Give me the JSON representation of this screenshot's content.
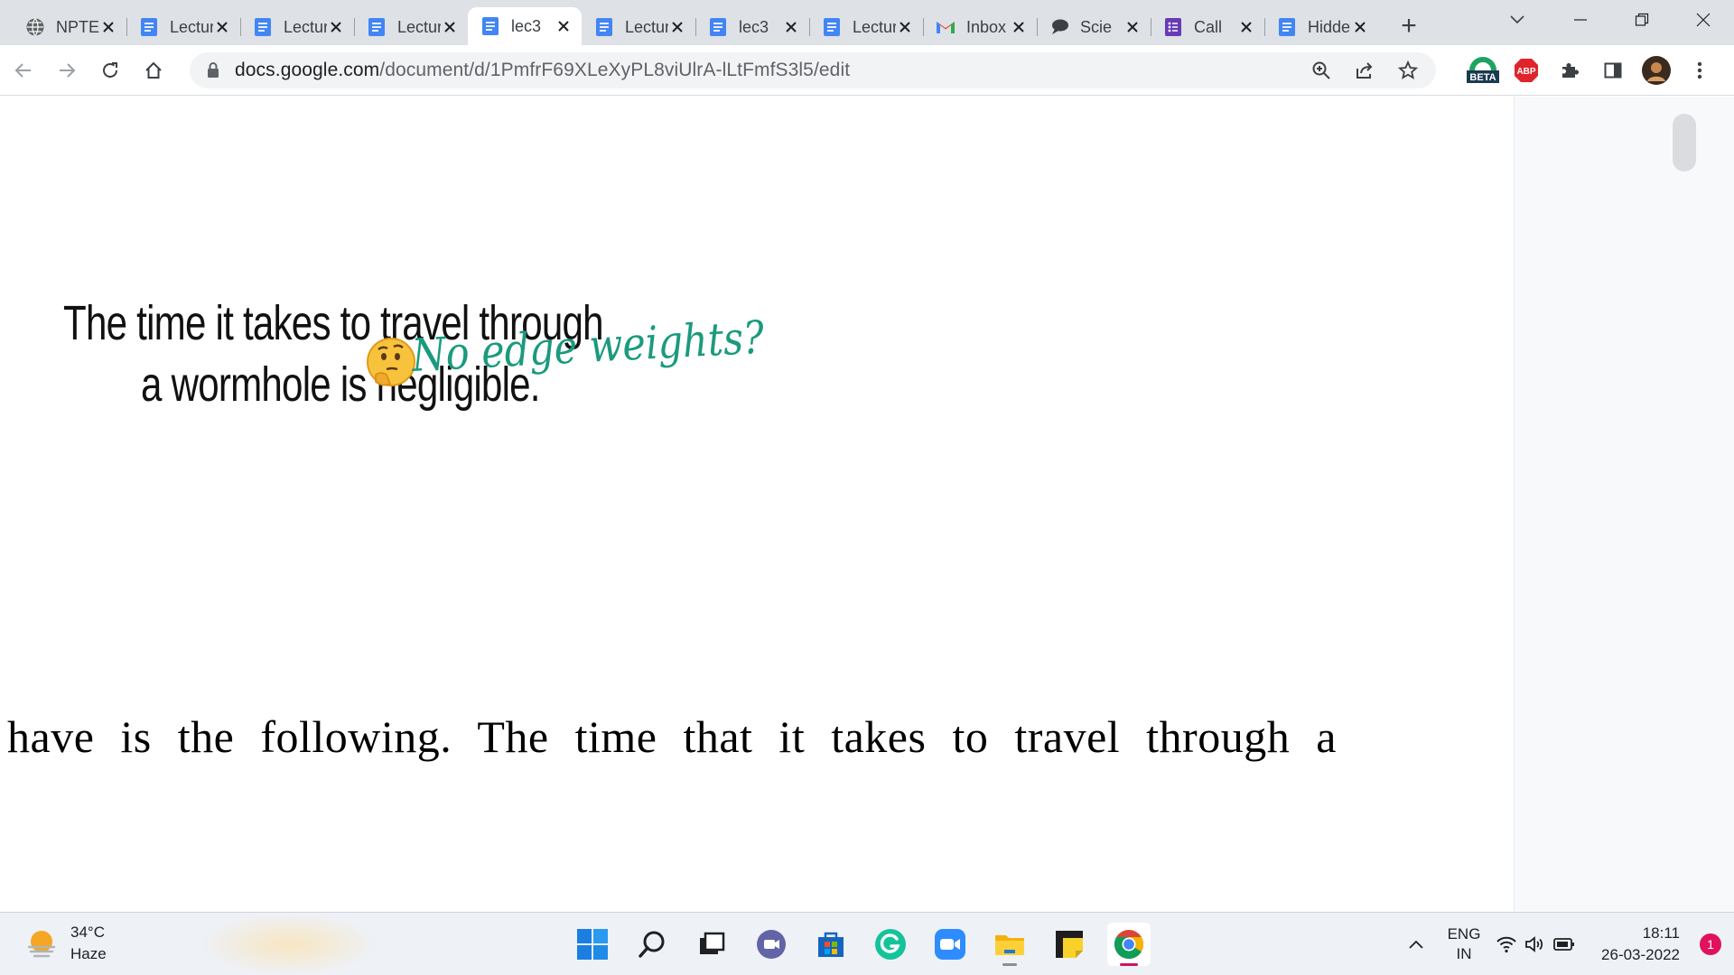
{
  "browser": {
    "tabs": [
      {
        "title": "NPTEL",
        "favicon": "globe-icon",
        "active": false
      },
      {
        "title": "Lecture",
        "favicon": "google-docs-icon",
        "active": false
      },
      {
        "title": "Lecture",
        "favicon": "google-docs-icon",
        "active": false
      },
      {
        "title": "Lecture",
        "favicon": "google-docs-icon",
        "active": false
      },
      {
        "title": "lec3",
        "favicon": "google-docs-icon",
        "active": true
      },
      {
        "title": "Lecture",
        "favicon": "google-docs-icon",
        "active": false
      },
      {
        "title": "lec3",
        "favicon": "google-docs-icon",
        "active": false
      },
      {
        "title": "Lecture",
        "favicon": "google-docs-icon",
        "active": false
      },
      {
        "title": "Inbox",
        "favicon": "gmail-icon",
        "active": false
      },
      {
        "title": "Scie",
        "favicon": "chat-bubble-icon",
        "active": false
      },
      {
        "title": "Call",
        "favicon": "google-forms-icon",
        "active": false
      },
      {
        "title": "Hidden",
        "favicon": "google-docs-icon",
        "active": false
      }
    ],
    "new_tab_label": "+",
    "url_host": "docs.google.com",
    "url_path": "/document/d/1PmfrF69XLeXyPL8viUlrA-lLtFmfS3l5/edit",
    "ext_beta_label": "BETA",
    "ext_abp_label": "ABP"
  },
  "document": {
    "handwritten_line1": "The time it takes to travel through",
    "handwritten_line2": "a wormhole is negligible.",
    "script_note": "No edge weights?",
    "transcript": "have is the following. The time that it takes to travel through a"
  },
  "taskbar": {
    "temperature": "34°C",
    "weather": "Haze",
    "lang_top": "ENG",
    "lang_bottom": "IN",
    "time": "18:11",
    "date": "26-03-2022",
    "notification_count": "1"
  },
  "colors": {
    "docs_blue": "#4285f4",
    "script_green": "#1b9a7e",
    "abp_red": "#e0242b",
    "accent_pink": "#c9165e"
  }
}
